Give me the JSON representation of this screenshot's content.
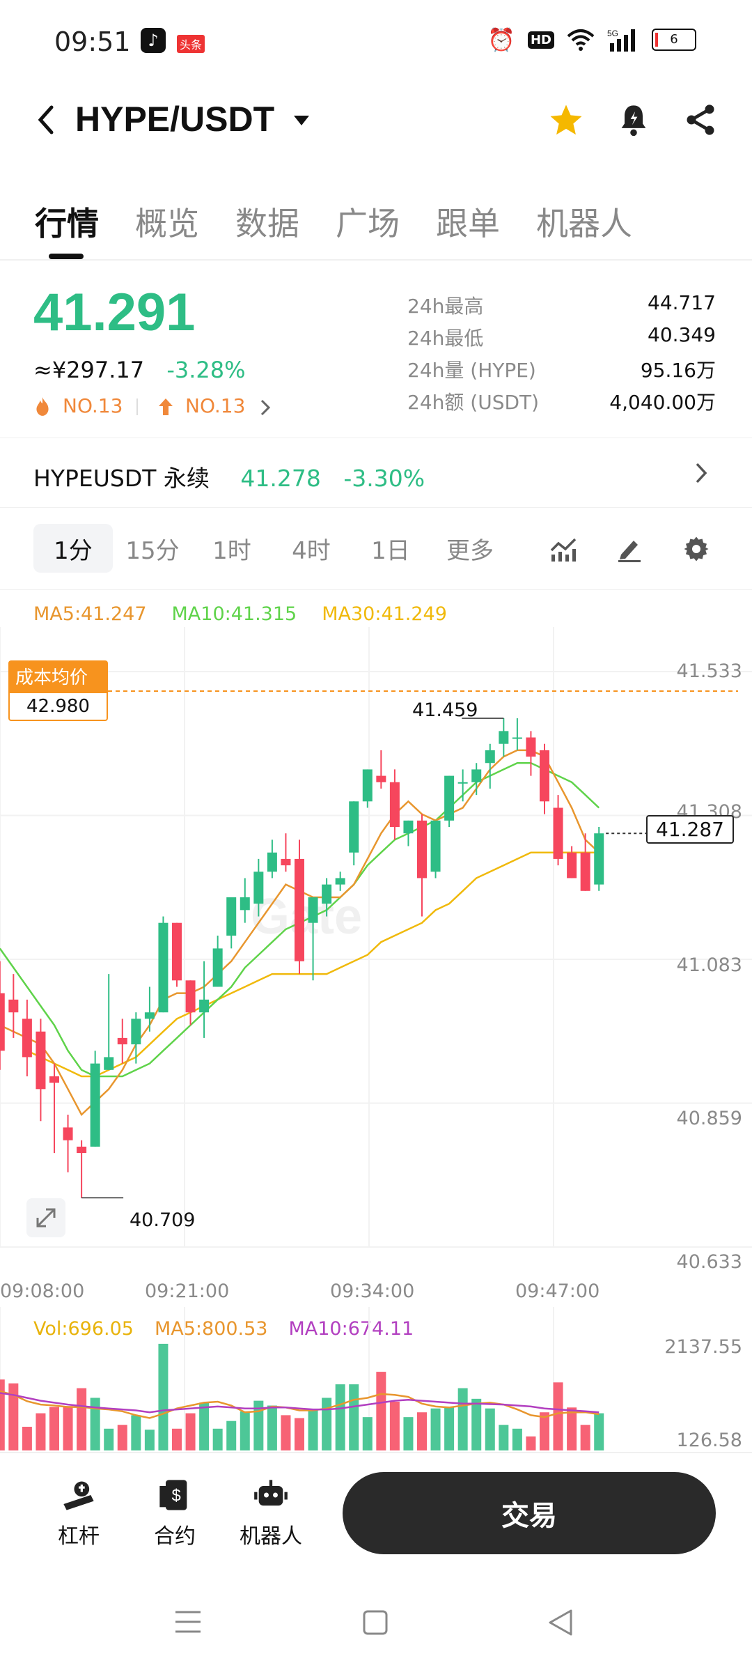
{
  "status": {
    "time": "09:51",
    "badge": "头条",
    "battery": "6"
  },
  "header": {
    "title": "HYPE/USDT"
  },
  "tabs": [
    "行情",
    "概览",
    "数据",
    "广场",
    "跟单",
    "机器人"
  ],
  "price": {
    "last": "41.291",
    "cny": "≈¥297.17",
    "change": "-3.28%",
    "rank1": "NO.13",
    "rank2": "NO.13"
  },
  "stats": [
    {
      "label": "24h最高",
      "value": "44.717"
    },
    {
      "label": "24h最低",
      "value": "40.349"
    },
    {
      "label": "24h量 (HYPE)",
      "value": "95.16万"
    },
    {
      "label": "24h额 (USDT)",
      "value": "4,040.00万"
    }
  ],
  "perpetual": {
    "name": "HYPEUSDT 永续",
    "price": "41.278",
    "change": "-3.30%"
  },
  "timeframes": [
    "1分",
    "15分",
    "1时",
    "4时",
    "1日",
    "更多"
  ],
  "ma": {
    "ma5": "MA5:41.247",
    "ma10": "MA10:41.315",
    "ma30": "MA30:41.249"
  },
  "cost_avg": {
    "label": "成本均价",
    "value": "42.980"
  },
  "watermark": "Gate",
  "vol_legend": {
    "vol": "Vol:696.05",
    "ma5": "MA5:800.53",
    "ma10": "MA10:674.11"
  },
  "bottom": {
    "leverage": "杠杆",
    "contract": "合约",
    "robot": "机器人",
    "trade": "交易"
  },
  "colors": {
    "up": "#2EBD85",
    "down": "#F6465D",
    "ma5": "#E8962E",
    "ma10": "#5FD34A",
    "ma30": "#F0B90B"
  },
  "chart_data": {
    "type": "candlestick",
    "y_ticks": [
      "41.533",
      "41.308",
      "41.083",
      "40.859",
      "40.633"
    ],
    "ylim": [
      40.633,
      41.533
    ],
    "x_ticks": [
      "09:08:00",
      "09:21:00",
      "09:34:00",
      "09:47:00"
    ],
    "high_label": "41.459",
    "low_label": "40.709",
    "current_label": "41.287",
    "candles": [
      {
        "o": 41.03,
        "h": 41.08,
        "l": 40.91,
        "c": 40.94
      },
      {
        "o": 41.02,
        "h": 41.06,
        "l": 40.96,
        "c": 41.0
      },
      {
        "o": 40.99,
        "h": 41.02,
        "l": 40.9,
        "c": 40.93
      },
      {
        "o": 40.97,
        "h": 40.99,
        "l": 40.83,
        "c": 40.88
      },
      {
        "o": 40.9,
        "h": 40.92,
        "l": 40.78,
        "c": 40.89
      },
      {
        "o": 40.82,
        "h": 40.84,
        "l": 40.75,
        "c": 40.8
      },
      {
        "o": 40.79,
        "h": 40.8,
        "l": 40.71,
        "c": 40.78
      },
      {
        "o": 40.79,
        "h": 40.94,
        "l": 40.79,
        "c": 40.92
      },
      {
        "o": 40.91,
        "h": 41.06,
        "l": 40.91,
        "c": 40.93
      },
      {
        "o": 40.96,
        "h": 40.99,
        "l": 40.92,
        "c": 40.95
      },
      {
        "o": 40.95,
        "h": 41.0,
        "l": 40.92,
        "c": 40.99
      },
      {
        "o": 40.99,
        "h": 41.04,
        "l": 40.97,
        "c": 41.0
      },
      {
        "o": 41.0,
        "h": 41.15,
        "l": 41.0,
        "c": 41.14
      },
      {
        "o": 41.14,
        "h": 41.14,
        "l": 41.04,
        "c": 41.05
      },
      {
        "o": 41.05,
        "h": 41.05,
        "l": 40.98,
        "c": 41.0
      },
      {
        "o": 41.0,
        "h": 41.08,
        "l": 40.96,
        "c": 41.02
      },
      {
        "o": 41.04,
        "h": 41.12,
        "l": 41.04,
        "c": 41.1
      },
      {
        "o": 41.12,
        "h": 41.17,
        "l": 41.1,
        "c": 41.18
      },
      {
        "o": 41.16,
        "h": 41.21,
        "l": 41.14,
        "c": 41.18
      },
      {
        "o": 41.17,
        "h": 41.24,
        "l": 41.15,
        "c": 41.22
      },
      {
        "o": 41.22,
        "h": 41.27,
        "l": 41.21,
        "c": 41.25
      },
      {
        "o": 41.24,
        "h": 41.28,
        "l": 41.22,
        "c": 41.23
      },
      {
        "o": 41.24,
        "h": 41.27,
        "l": 41.06,
        "c": 41.08
      },
      {
        "o": 41.14,
        "h": 41.18,
        "l": 41.05,
        "c": 41.18
      },
      {
        "o": 41.17,
        "h": 41.21,
        "l": 41.15,
        "c": 41.2
      },
      {
        "o": 41.2,
        "h": 41.22,
        "l": 41.19,
        "c": 41.21
      },
      {
        "o": 41.25,
        "h": 41.33,
        "l": 41.23,
        "c": 41.33
      },
      {
        "o": 41.33,
        "h": 41.38,
        "l": 41.32,
        "c": 41.38
      },
      {
        "o": 41.37,
        "h": 41.41,
        "l": 41.35,
        "c": 41.36
      },
      {
        "o": 41.36,
        "h": 41.38,
        "l": 41.27,
        "c": 41.29
      },
      {
        "o": 41.28,
        "h": 41.3,
        "l": 41.26,
        "c": 41.3
      },
      {
        "o": 41.3,
        "h": 41.31,
        "l": 41.15,
        "c": 41.21
      },
      {
        "o": 41.22,
        "h": 41.3,
        "l": 41.21,
        "c": 41.3
      },
      {
        "o": 41.3,
        "h": 41.37,
        "l": 41.29,
        "c": 41.37
      },
      {
        "o": 41.36,
        "h": 41.38,
        "l": 41.33,
        "c": 41.36
      },
      {
        "o": 41.36,
        "h": 41.39,
        "l": 41.34,
        "c": 41.38
      },
      {
        "o": 41.39,
        "h": 41.42,
        "l": 41.35,
        "c": 41.41
      },
      {
        "o": 41.42,
        "h": 41.46,
        "l": 41.4,
        "c": 41.44
      },
      {
        "o": 41.43,
        "h": 41.46,
        "l": 41.41,
        "c": 41.43
      },
      {
        "o": 41.43,
        "h": 41.44,
        "l": 41.37,
        "c": 41.4
      },
      {
        "o": 41.41,
        "h": 41.42,
        "l": 41.31,
        "c": 41.33
      },
      {
        "o": 41.32,
        "h": 41.34,
        "l": 41.23,
        "c": 41.24
      },
      {
        "o": 41.25,
        "h": 41.26,
        "l": 41.21,
        "c": 41.21
      },
      {
        "o": 41.25,
        "h": 41.28,
        "l": 41.19,
        "c": 41.19
      },
      {
        "o": 41.2,
        "h": 41.29,
        "l": 41.19,
        "c": 41.28
      }
    ],
    "ma5": [
      40.98,
      40.97,
      40.96,
      40.95,
      40.92,
      40.88,
      40.84,
      40.86,
      40.88,
      40.91,
      40.95,
      40.98,
      41.02,
      41.03,
      41.03,
      41.04,
      41.06,
      41.08,
      41.11,
      41.14,
      41.17,
      41.2,
      41.19,
      41.18,
      41.18,
      41.18,
      41.2,
      41.24,
      41.28,
      41.31,
      41.33,
      41.31,
      41.3,
      41.31,
      41.32,
      41.35,
      41.38,
      41.4,
      41.41,
      41.41,
      41.4,
      41.36,
      41.32,
      41.27,
      41.25
    ],
    "ma10": [
      41.1,
      41.07,
      41.04,
      41.01,
      40.98,
      40.94,
      40.91,
      40.9,
      40.9,
      40.9,
      40.91,
      40.92,
      40.94,
      40.96,
      40.98,
      41.0,
      41.02,
      41.04,
      41.07,
      41.09,
      41.11,
      41.13,
      41.14,
      41.15,
      41.16,
      41.18,
      41.2,
      41.23,
      41.25,
      41.27,
      41.28,
      41.29,
      41.3,
      41.32,
      41.34,
      41.36,
      41.37,
      41.38,
      41.39,
      41.39,
      41.38,
      41.37,
      41.36,
      41.34,
      41.32
    ],
    "ma30": [
      null,
      null,
      40.94,
      40.93,
      40.92,
      40.91,
      40.9,
      40.9,
      40.91,
      40.92,
      40.93,
      40.95,
      40.97,
      40.99,
      41.0,
      41.01,
      41.02,
      41.03,
      41.04,
      41.05,
      41.06,
      41.06,
      41.06,
      41.06,
      41.06,
      41.07,
      41.08,
      41.09,
      41.11,
      41.12,
      41.13,
      41.14,
      41.16,
      41.17,
      41.19,
      41.21,
      41.22,
      41.23,
      41.24,
      41.25,
      41.25,
      41.25,
      41.25,
      41.25,
      41.25
    ],
    "volume": {
      "ticks": [
        "2137.55",
        "126.58"
      ],
      "ylim": [
        0,
        2137.55
      ],
      "values": [
        1500,
        1420,
        520,
        800,
        930,
        950,
        1320,
        1120,
        480,
        560,
        760,
        460,
        2240,
        480,
        800,
        1020,
        480,
        640,
        840,
        1060,
        960,
        760,
        700,
        860,
        1120,
        1400,
        1400,
        720,
        1660,
        1040,
        720,
        820,
        900,
        920,
        1320,
        1100,
        900,
        560,
        480,
        320,
        820,
        1440,
        920,
        560,
        800
      ],
      "ma5": [
        1260,
        1180,
        1050,
        980,
        960,
        930,
        930,
        900,
        880,
        840,
        760,
        700,
        790,
        900,
        960,
        1020,
        1040,
        960,
        820,
        840,
        940,
        920,
        860,
        860,
        900,
        980,
        1080,
        1120,
        1200,
        1180,
        1140,
        1000,
        940,
        920,
        960,
        1000,
        1020,
        980,
        880,
        760,
        720,
        800,
        820,
        820,
        780
      ],
      "ma10": [
        1220,
        1180,
        1120,
        1060,
        1020,
        980,
        950,
        920,
        900,
        880,
        860,
        820,
        860,
        880,
        900,
        920,
        940,
        920,
        900,
        900,
        920,
        920,
        900,
        880,
        880,
        900,
        940,
        980,
        1020,
        1060,
        1080,
        1060,
        1040,
        1020,
        1000,
        1000,
        990,
        980,
        960,
        940,
        900,
        880,
        860,
        840,
        820
      ]
    }
  }
}
